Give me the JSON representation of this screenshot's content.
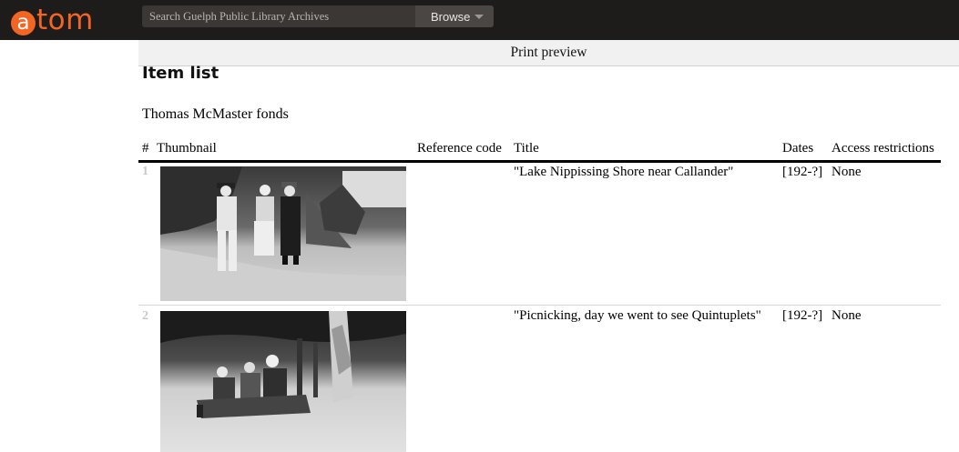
{
  "header": {
    "logo_letter": "a",
    "logo_rest": "tom",
    "search_placeholder": "Search Guelph Public Library Archives",
    "browse_label": "Browse",
    "colors": {
      "bar": "#1e1c1b",
      "brand": "#f26522"
    }
  },
  "print_preview_label": "Print preview",
  "page_title": "Item list",
  "fonds_title": "Thomas McMaster fonds",
  "table": {
    "columns": {
      "number": "#",
      "thumbnail": "Thumbnail",
      "reference_code": "Reference code",
      "title": "Title",
      "dates": "Dates",
      "access": "Access restrictions"
    },
    "rows": [
      {
        "number": "1",
        "thumbnail_icon": "photo-thumbnail-lake-shore",
        "reference_code": "",
        "title": "\"Lake Nippissing Shore near Callander\"",
        "dates": "[192-?]",
        "access": "None"
      },
      {
        "number": "2",
        "thumbnail_icon": "photo-thumbnail-picnic",
        "reference_code": "",
        "title": "\"Picnicking, day we went to see Quintuplets\"",
        "dates": "[192-?]",
        "access": "None"
      }
    ]
  }
}
